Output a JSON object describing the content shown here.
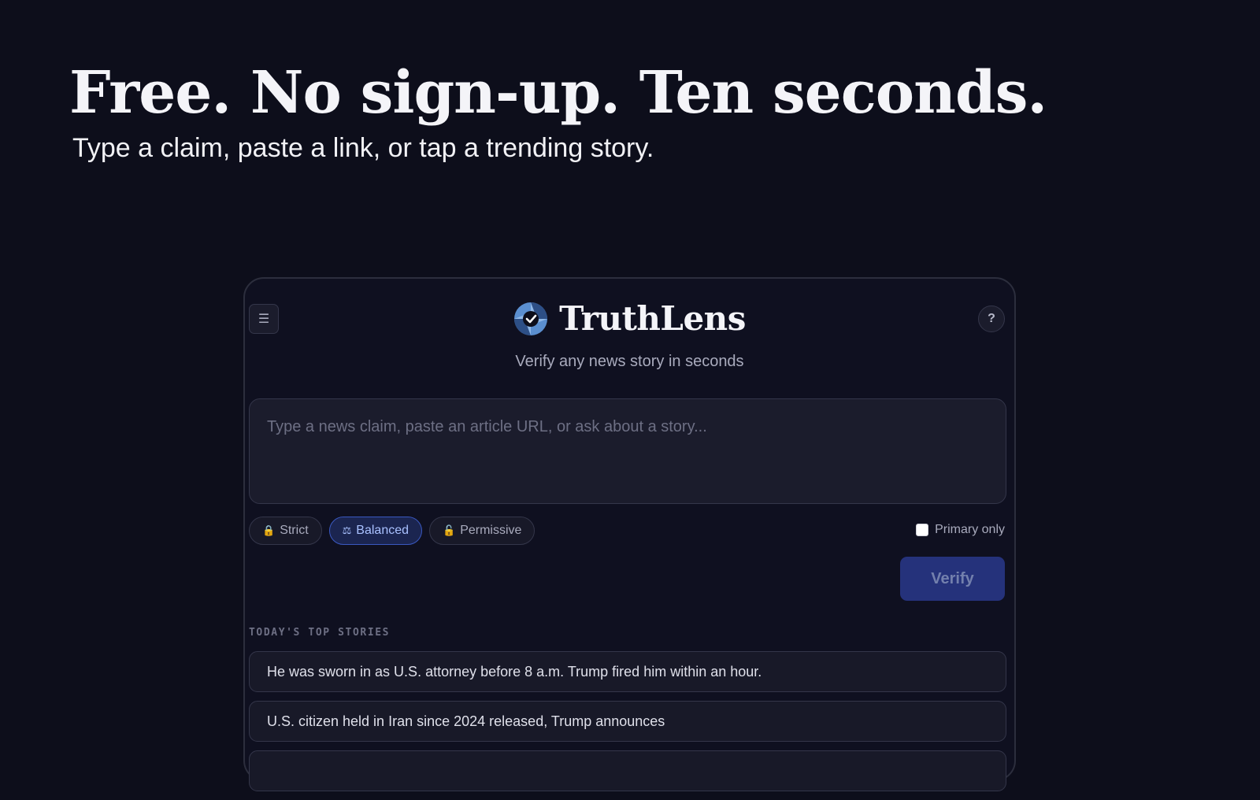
{
  "hero": {
    "headline": "Free. No sign-up. Ten seconds.",
    "subheadline": "Type a claim, paste a link, or tap a trending story."
  },
  "app": {
    "name": "TruthLens",
    "tagline": "Verify any news story in seconds",
    "menu_icon": "☰",
    "help_label": "?"
  },
  "search": {
    "placeholder": "Type a news claim, paste an article URL, or ask about a story..."
  },
  "modes": [
    {
      "label": "Strict",
      "icon": "🔒",
      "active": false
    },
    {
      "label": "Balanced",
      "icon": "⚖",
      "active": true
    },
    {
      "label": "Permissive",
      "icon": "🔓",
      "active": false
    }
  ],
  "filters": {
    "primary_only_label": "Primary only",
    "primary_only_checked": false
  },
  "actions": {
    "verify_label": "Verify"
  },
  "stories": {
    "title": "TODAY'S TOP STORIES",
    "items": [
      "He was sworn in as U.S. attorney before 8 a.m. Trump fired him within an hour.",
      "U.S. citizen held in Iran since 2024 released, Trump announces"
    ]
  },
  "colors": {
    "background": "#0d0e1b",
    "accent": "#3a58c0",
    "verify_button": "#25327b"
  }
}
